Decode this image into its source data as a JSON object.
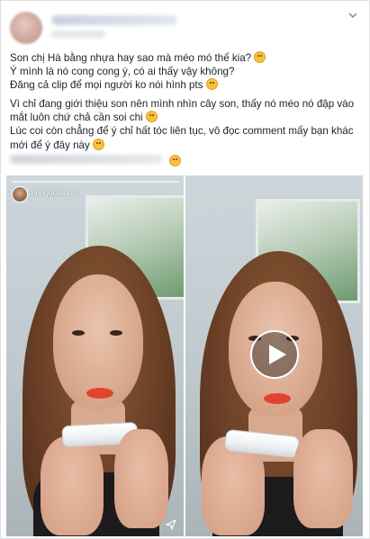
{
  "post": {
    "lines": [
      "Son chị Hà bằng nhựa hay sao mà méo mó thế kia?",
      "Ý mình là nó cong cong ý, có ai thấy vậy không?",
      "Đăng cả clip để mọi người ko nói hình pts",
      "Vì chỉ đang giới thiệu son nên mình nhìn cây son, thấy nó méo nó đập vào",
      "mắt luôn chứ chả cần soi chi",
      "Lúc coi còn chẳng để ý chỉ hất tóc liên tục, vô đọc comment mấy bạn khác",
      "mới để ý đây này"
    ]
  },
  "story": {
    "username": "hongocha",
    "time": "2h"
  },
  "icons": {
    "menu": "chevron-down-icon",
    "play": "play-icon",
    "send": "send-icon"
  }
}
